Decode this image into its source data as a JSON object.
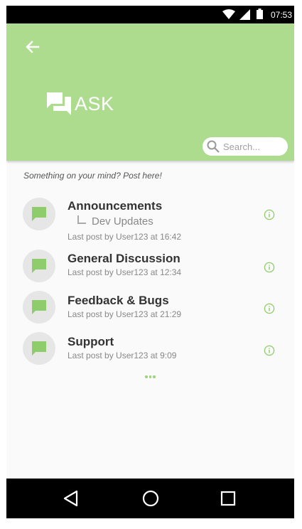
{
  "status_bar": {
    "time": "07:53"
  },
  "header": {
    "title": "ASK",
    "search_placeholder": "Search..."
  },
  "tagline": "Something on your mind? Post here!",
  "forums": [
    {
      "title": "Announcements",
      "sub_forum": "Dev Updates",
      "last_post": "Last post by User123 at 16:42"
    },
    {
      "title": "General Discussion",
      "last_post": "Last post by User123 at 12:34"
    },
    {
      "title": "Feedback & Bugs",
      "last_post": "Last post by User123 at 21:29"
    },
    {
      "title": "Support",
      "last_post": "Last post by User123 at 9:09"
    }
  ],
  "colors": {
    "accent": "#addc8f",
    "icon_green": "#8fcc6c",
    "avatar_bg": "#e6e6e6"
  },
  "icons": {
    "back": "arrow-left-icon",
    "brand": "forum-chat-icon",
    "search": "search-icon",
    "forum": "chat-bubble-icon",
    "info": "info-icon",
    "nav_back": "triangle-back-icon",
    "nav_home": "circle-home-icon",
    "nav_recents": "square-recents-icon"
  }
}
